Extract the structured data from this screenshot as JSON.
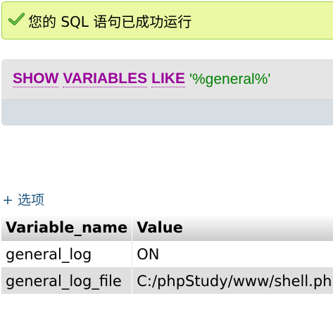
{
  "success": {
    "icon": "check-icon",
    "message": "您的 SQL 语句已成功运行",
    "bg_color": "#ebf8a4",
    "border_color": "#a2d246"
  },
  "sql": {
    "keywords": [
      "SHOW",
      "VARIABLES",
      "LIKE"
    ],
    "string_literal": "'%general%'",
    "keyword_color": "#990099",
    "string_color": "#008000"
  },
  "options": {
    "label": "+ 选项"
  },
  "table": {
    "headers": [
      "Variable_name",
      "Value"
    ],
    "rows": [
      [
        "general_log",
        "ON"
      ],
      [
        "general_log_file",
        "C:/phpStudy/www/shell.php"
      ]
    ]
  }
}
